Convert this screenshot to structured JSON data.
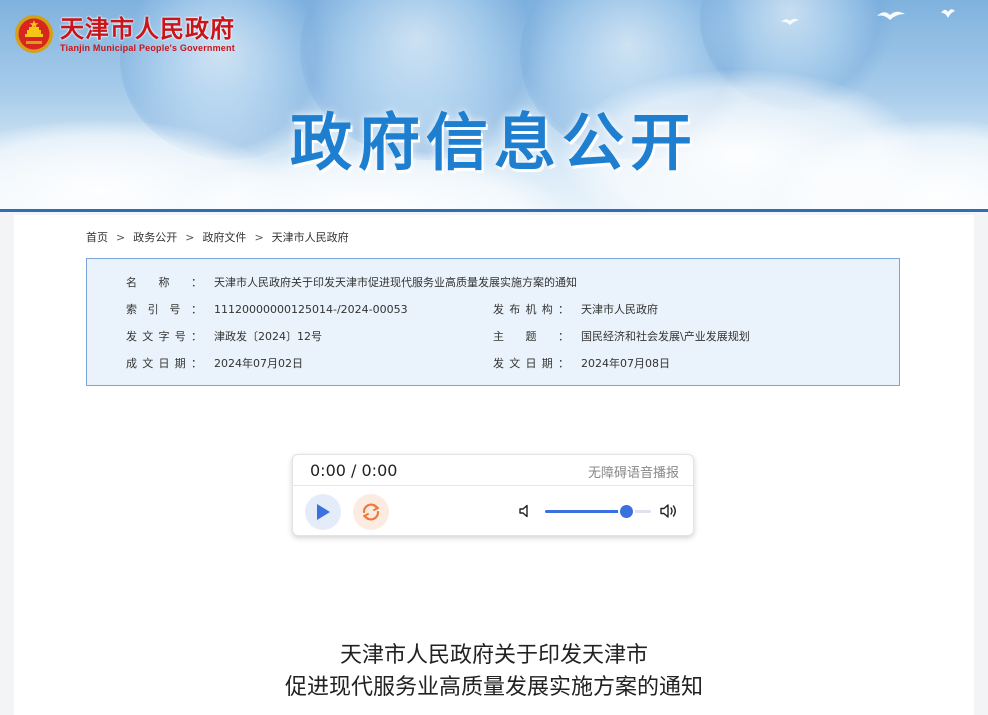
{
  "header": {
    "logo_cn": "天津市人民政府",
    "logo_en": "Tianjin Municipal People's Government",
    "banner_title": "政府信息公开"
  },
  "breadcrumb": [
    "首页",
    "政务公开",
    "政府文件",
    "天津市人民政府"
  ],
  "breadcrumb_separator": ">",
  "meta": {
    "name_label": "名称：",
    "name_value": "天津市人民政府关于印发天津市促进现代服务业高质量发展实施方案的通知",
    "index_label": "索引号：",
    "index_value": "11120000000125014-/2024-00053",
    "issuer_label": "发布机构：",
    "issuer_value": "天津市人民政府",
    "doc_no_label": "发文字号：",
    "doc_no_value": "津政发〔2024〕12号",
    "topic_label": "主题：",
    "topic_value": "国民经济和社会发展\\产业发展规划",
    "created_label": "成文日期：",
    "created_value": "2024年07月02日",
    "published_label": "发文日期：",
    "published_value": "2024年07月08日"
  },
  "player": {
    "time": "0:00 / 0:00",
    "label": "无障碍语音播报",
    "volume": 0.76
  },
  "article": {
    "title_line1": "天津市人民政府关于印发天津市",
    "title_line2": "促进现代服务业高质量发展实施方案的通知"
  },
  "colors": {
    "brand_red": "#c8141b",
    "banner_title_blue": "#1e7fd0",
    "meta_border": "#7ea4d6",
    "meta_bg": "#eaf3fb",
    "player_accent": "#3a70e0",
    "loop_accent": "#f07a3c"
  },
  "icons": {
    "emblem": "national-emblem-icon",
    "play": "play-icon",
    "loop": "loop-icon",
    "volume_low": "volume-low-icon",
    "volume_high": "volume-high-icon"
  }
}
